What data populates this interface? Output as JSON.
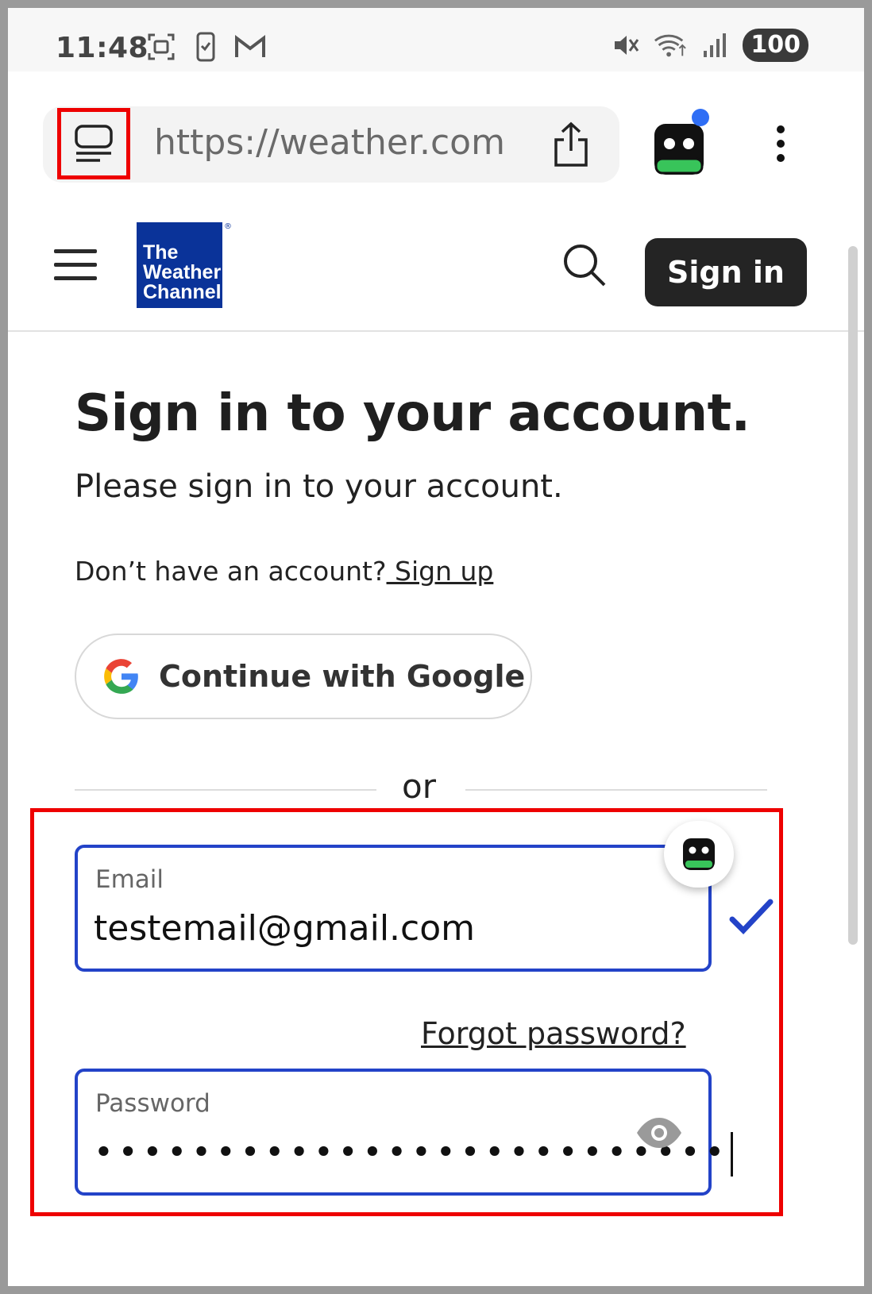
{
  "status_bar": {
    "time": "11:48",
    "battery": "100",
    "left_icons": [
      "screenshot-icon",
      "phone-icon",
      "gmail-icon"
    ],
    "right_icons": [
      "mute-icon",
      "wifi-icon",
      "signal-icon"
    ]
  },
  "browser": {
    "url": "https://weather.com/",
    "icons": [
      "tab-icon",
      "share-icon",
      "robot-extension-icon",
      "more-icon"
    ],
    "notification_color": "#2f6ef5"
  },
  "site": {
    "logo_lines": [
      "The",
      "Weather",
      "Channel"
    ],
    "logo_color": "#0a3399",
    "signin_label": "Sign in"
  },
  "page": {
    "title": "Sign in to your account.",
    "subtitle": "Please sign in to your account.",
    "no_account_text": "Don’t have an account?",
    "signup_link": " Sign up",
    "google_button": "Continue with Google",
    "or_text": "or"
  },
  "form": {
    "email_label": "Email",
    "email_value": "testemail@gmail.com",
    "forgot_password": "Forgot password?",
    "password_label": "Password",
    "password_mask": "••••••••••••••••••••••••••",
    "accent_color": "#2343c8"
  }
}
